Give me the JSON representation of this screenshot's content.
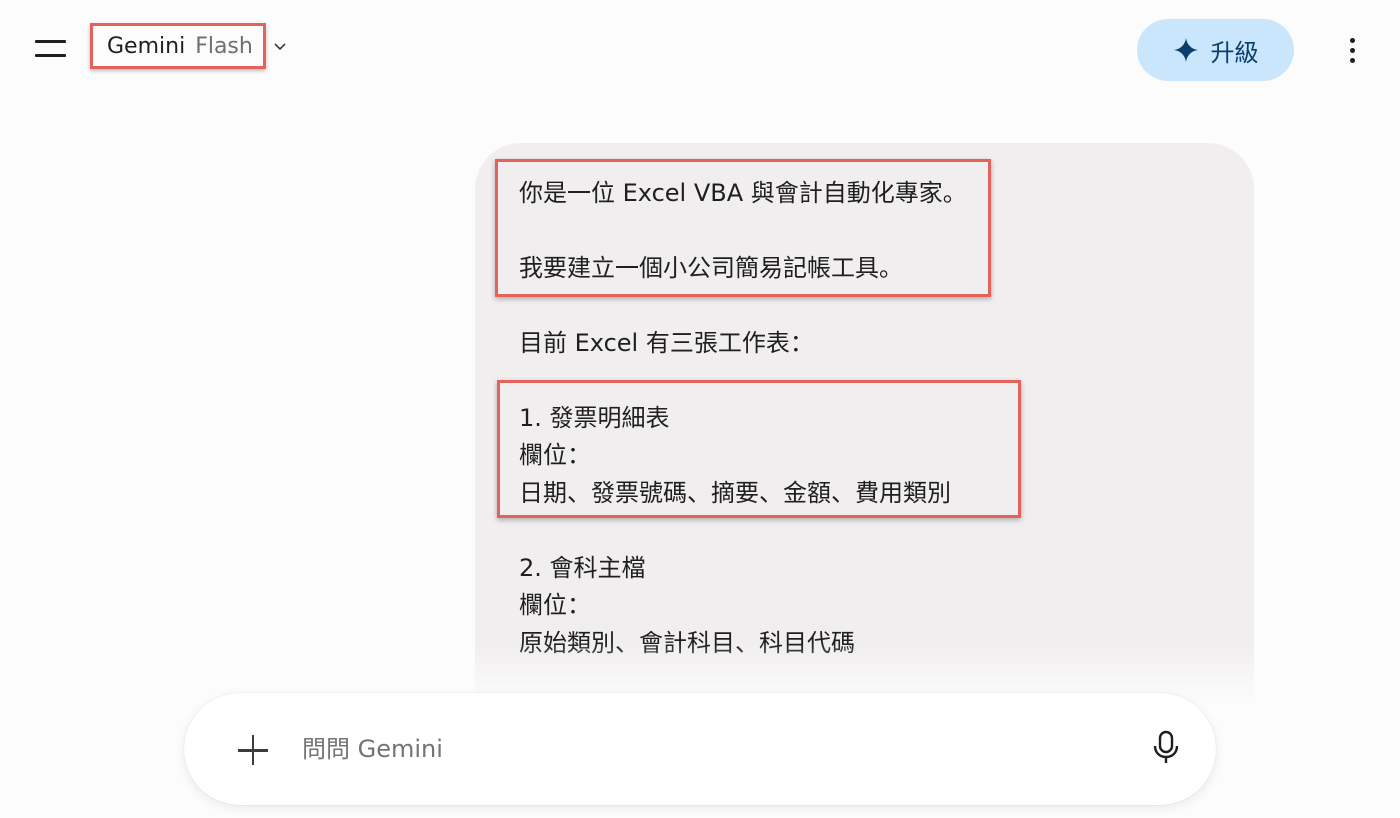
{
  "header": {
    "model_name": "Gemini",
    "model_variant": "Flash",
    "upgrade_label": "升級"
  },
  "message": {
    "lines": [
      "你是一位 Excel VBA 與會計自動化專家。",
      "我要建立一個小公司簡易記帳工具。",
      "目前 Excel 有三張工作表：",
      "1. 發票明細表",
      "欄位：",
      "日期、發票號碼、摘要、金額、費用類別",
      "2. 會科主檔",
      "欄位：",
      "原始類別、會計科目、科目代碼"
    ]
  },
  "input": {
    "placeholder": "問問 Gemini",
    "value": ""
  },
  "icons": {
    "menu": "menu-icon",
    "chevron": "chevron-down-icon",
    "spark": "spark-icon",
    "more": "more-vert-icon",
    "plus": "plus-icon",
    "mic": "mic-icon"
  },
  "colors": {
    "highlight": "#e3625a",
    "upgrade_bg": "#c9e6fd",
    "upgrade_text": "#0b3e6e",
    "bubble_bg": "#f0eeef"
  }
}
